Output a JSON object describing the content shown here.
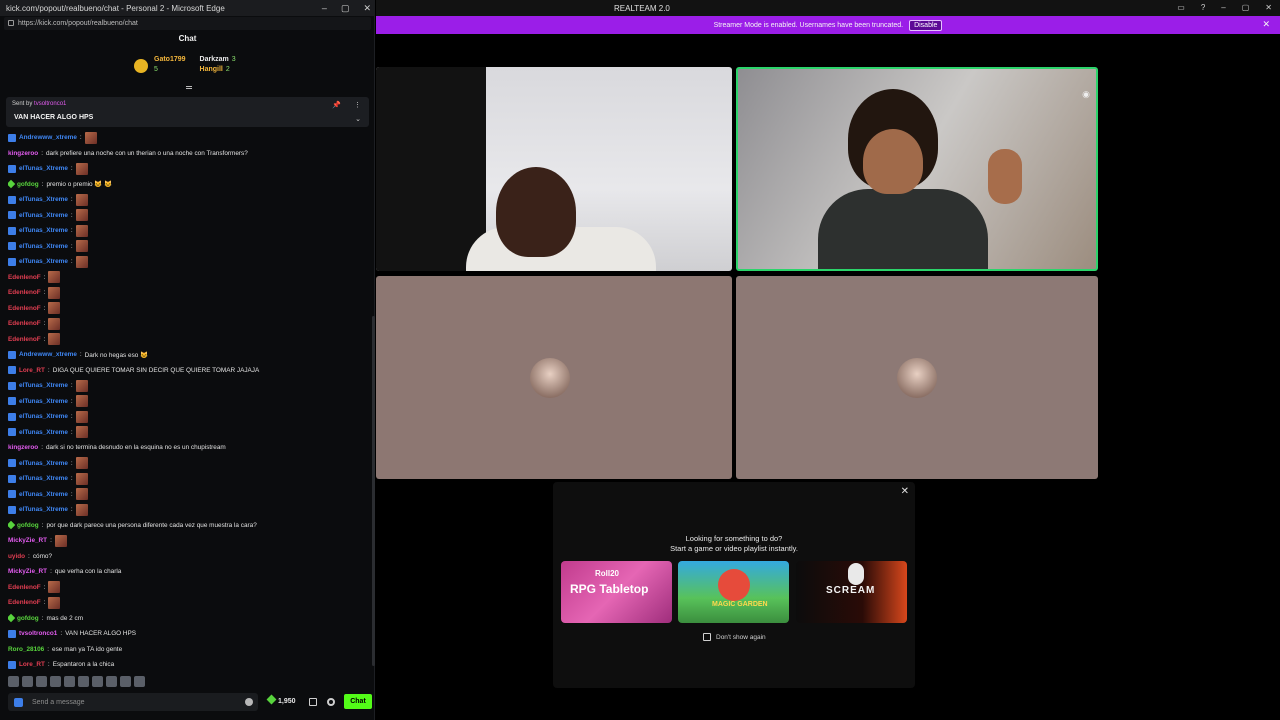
{
  "edge": {
    "title": "kick.com/popout/realbueno/chat - Personal 2 - Microsoft Edge",
    "url": "https://kick.com/popout/realbueno/chat",
    "controls": [
      "–",
      "▢",
      "✕"
    ]
  },
  "chat": {
    "header": "Chat",
    "leaderboard": [
      {
        "name": "Gato1799",
        "points": "5"
      },
      {
        "name": "Darkzam",
        "points": "3"
      },
      {
        "name": "Hangill",
        "points": "2"
      }
    ],
    "pinned": {
      "sent_by_prefix": "Sent by",
      "sent_by_user": "tvsoltronco1",
      "message": "VAN HACER ALGO HPS"
    },
    "messages": [
      {
        "user": "Andrewww_xtreme",
        "text": "",
        "color": "#3f87f5",
        "badge": true,
        "emote": true
      },
      {
        "user": "kingzeroo",
        "text": "dark prefiere una noche con un therian o una noche con Transformers?",
        "color": "#e35cf0",
        "badge": false
      },
      {
        "user": "elTunas_Xtreme",
        "text": "",
        "color": "#3f87f5",
        "badge": true,
        "emote": true
      },
      {
        "user": "gofdog",
        "text": "premio o premio 😺 😺",
        "color": "#58d43d",
        "badge": false,
        "points": true
      },
      {
        "user": "elTunas_Xtreme",
        "text": "",
        "color": "#3f87f5",
        "badge": true,
        "emote": true
      },
      {
        "user": "elTunas_Xtreme",
        "text": "",
        "color": "#3f87f5",
        "badge": true,
        "emote": true
      },
      {
        "user": "elTunas_Xtreme",
        "text": "",
        "color": "#3f87f5",
        "badge": true,
        "emote": true
      },
      {
        "user": "elTunas_Xtreme",
        "text": "",
        "color": "#3f87f5",
        "badge": true,
        "emote": true
      },
      {
        "user": "elTunas_Xtreme",
        "text": "",
        "color": "#3f87f5",
        "badge": true,
        "emote": true
      },
      {
        "user": "EdenlenoF",
        "text": "",
        "color": "#e23e52",
        "badge": false,
        "emote": true
      },
      {
        "user": "EdenlenoF",
        "text": "",
        "color": "#e23e52",
        "badge": false,
        "emote": true
      },
      {
        "user": "EdenlenoF",
        "text": "",
        "color": "#e23e52",
        "badge": false,
        "emote": true
      },
      {
        "user": "EdenlenoF",
        "text": "",
        "color": "#e23e52",
        "badge": false,
        "emote": true
      },
      {
        "user": "EdenlenoF",
        "text": "",
        "color": "#e23e52",
        "badge": false,
        "emote": true
      },
      {
        "user": "Andrewww_xtreme",
        "text": "Dark no hegas eso 😺",
        "color": "#3f87f5",
        "badge": true
      },
      {
        "user": "Lore_RT",
        "text": "DIGA QUE QUIERE TOMAR SIN DECIR QUE QUIERE TOMAR JAJAJA",
        "color": "#e23e52",
        "badge": true
      },
      {
        "user": "elTunas_Xtreme",
        "text": "",
        "color": "#3f87f5",
        "badge": true,
        "emote": true
      },
      {
        "user": "elTunas_Xtreme",
        "text": "",
        "color": "#3f87f5",
        "badge": true,
        "emote": true
      },
      {
        "user": "elTunas_Xtreme",
        "text": "",
        "color": "#3f87f5",
        "badge": true,
        "emote": true
      },
      {
        "user": "elTunas_Xtreme",
        "text": "",
        "color": "#3f87f5",
        "badge": true,
        "emote": true
      },
      {
        "user": "kingzeroo",
        "text": "dark si no termina desnudo en la esquina no es un chupistream",
        "color": "#e35cf0",
        "badge": false
      },
      {
        "user": "elTunas_Xtreme",
        "text": "",
        "color": "#3f87f5",
        "badge": true,
        "emote": true
      },
      {
        "user": "elTunas_Xtreme",
        "text": "",
        "color": "#3f87f5",
        "badge": true,
        "emote": true
      },
      {
        "user": "elTunas_Xtreme",
        "text": "",
        "color": "#3f87f5",
        "badge": true,
        "emote": true
      },
      {
        "user": "elTunas_Xtreme",
        "text": "",
        "color": "#3f87f5",
        "badge": true,
        "emote": true
      },
      {
        "user": "gofdog",
        "text": "por que dark parece una persona diferente cada vez que muestra la cara?",
        "color": "#58d43d",
        "badge": false,
        "points": true
      },
      {
        "user": "MickyZie_RT",
        "text": "",
        "color": "#e35cf0",
        "badge": false,
        "emote": true
      },
      {
        "user": "uyido",
        "text": "cómo?",
        "color": "#e23e52",
        "badge": false
      },
      {
        "user": "MickyZie_RT",
        "text": "que verha con la charla",
        "color": "#e35cf0",
        "badge": false
      },
      {
        "user": "EdenlenoF",
        "text": "",
        "color": "#e23e52",
        "badge": false,
        "emote": true
      },
      {
        "user": "EdenlenoF",
        "text": "",
        "color": "#e23e52",
        "badge": false,
        "emote": true
      },
      {
        "user": "gofdog",
        "text": "mas de 2 cm",
        "color": "#58d43d",
        "badge": false,
        "points": true
      },
      {
        "user": "tvsoltronco1",
        "text": "VAN HACER ALGO HPS",
        "color": "#e35cf0",
        "badge": true
      },
      {
        "user": "Roro_28106",
        "text": "ese man ya TA ido gente",
        "color": "#58d43d",
        "badge": false
      },
      {
        "user": "Lore_RT",
        "text": "Espantaron a la chica",
        "color": "#e23e52",
        "badge": true
      }
    ],
    "input_placeholder": "Send a message",
    "points": "1,950",
    "chat_button": "Chat"
  },
  "realteam": {
    "title": "REALTEAM 2.0",
    "streamer_notice": "Streamer Mode is enabled. Usernames have been truncated.",
    "disable_button": "Disable",
    "close": "✕",
    "game_panel": {
      "close": "✕",
      "question_line1": "Looking for something to do?",
      "question_line2": "Start a game or video playlist instantly.",
      "cards": [
        {
          "name": "rpg-tabletop",
          "brand": "Roll20",
          "label": "RPG Tabletop"
        },
        {
          "name": "magic-garden",
          "label": "MAGIC GARDEN"
        },
        {
          "name": "scream",
          "label": "SCREAM"
        }
      ],
      "dont_show": "Don't show again"
    }
  }
}
